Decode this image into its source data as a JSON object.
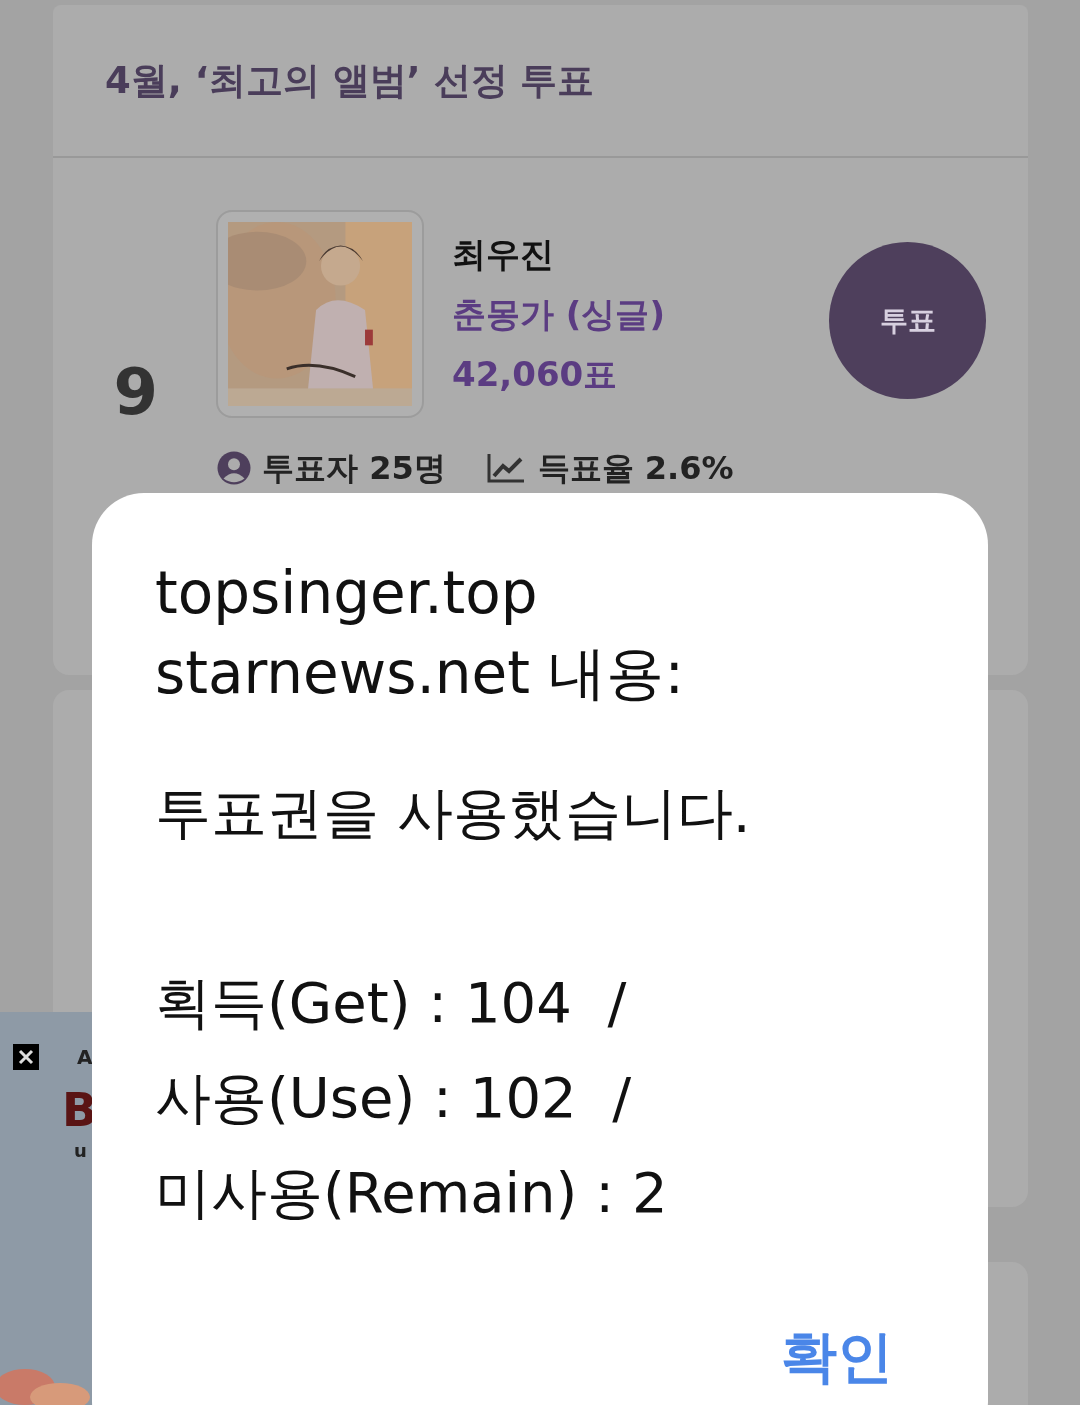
{
  "poll": {
    "title": "4월, ‘최고의 앨범’ 선정 투표"
  },
  "entry": {
    "rank": "9",
    "artist": "최우진",
    "album": "춘몽가 (싱글)",
    "votes": "42,060표",
    "vote_button": "투표",
    "voters": "투표자 25명",
    "share": "득표율 2.6%"
  },
  "ad": {
    "fragments": [
      "A",
      "B",
      "u"
    ]
  },
  "dialog": {
    "title_lines": [
      "topsinger.top",
      "starnews.net 내용:"
    ],
    "message": "투표권을 사용했습니다.",
    "tally_lines": [
      "획득(Get) : 104  /",
      "사용(Use) : 102  /",
      "미사용(Remain) : 2"
    ],
    "button": "확인"
  }
}
